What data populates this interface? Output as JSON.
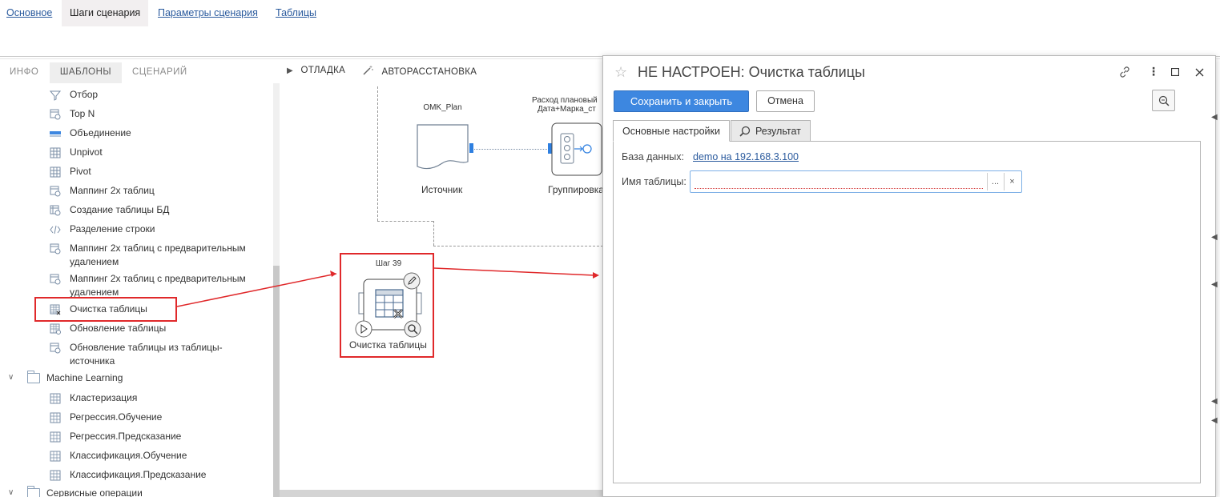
{
  "top_tabs": [
    "Основное",
    "Шаги сценария",
    "Параметры сценария",
    "Таблицы"
  ],
  "left_panel": {
    "tabs": [
      "ИНФО",
      "ШАБЛОНЫ",
      "СЦЕНАРИЙ"
    ],
    "items": [
      {
        "label": "Отбор",
        "icon": "filter-icon"
      },
      {
        "label": "Top N",
        "icon": "top-n-icon"
      },
      {
        "label": "Объединение",
        "icon": "union-icon"
      },
      {
        "label": "Unpivot",
        "icon": "unpivot-icon"
      },
      {
        "label": "Pivot",
        "icon": "pivot-icon"
      },
      {
        "label": "Маппинг 2х таблиц",
        "icon": "mapping-icon"
      },
      {
        "label": "Создание таблицы БД",
        "icon": "create-table-icon"
      },
      {
        "label": "Разделение строки",
        "icon": "code-icon"
      },
      {
        "label": "Маппинг 2х таблиц с предварительным удалением",
        "icon": "mapping-icon"
      },
      {
        "label": "Маппинг 2х таблиц с предварительным удалением",
        "icon": "mapping-icon"
      },
      {
        "label": "Очистка таблицы",
        "icon": "clear-table-icon"
      },
      {
        "label": "Обновление таблицы",
        "icon": "update-table-icon"
      },
      {
        "label": "Обновление таблицы из таблицы-источника",
        "icon": "mapping-icon"
      }
    ],
    "folders": [
      {
        "label": "Machine Learning",
        "items": [
          "Кластеризация",
          "Регрессия.Обучение",
          "Регрессия.Предсказание",
          "Классификация.Обучение",
          "Классификация.Предсказание"
        ]
      },
      {
        "label": "Сервисные операции",
        "items": []
      }
    ]
  },
  "toolbar": {
    "debug": "ОТЛАДКА",
    "auto_layout": "АВТОРАССТАНОВКА"
  },
  "canvas": {
    "source_node": {
      "title": "OMK_Plan",
      "label": "Источник"
    },
    "group_node": {
      "title": "Расход плановый",
      "title2": "Дата+Марка_ст",
      "label": "Группировка"
    },
    "step_node": {
      "title": "Шаг 39",
      "label": "Очистка таблицы"
    }
  },
  "dialog": {
    "title": "НЕ НАСТРОЕН: Очистка таблицы",
    "save_close": "Сохранить и закрыть",
    "cancel": "Отмена",
    "tabs": [
      "Основные настройки",
      "Результат"
    ],
    "db_label": "База данных:",
    "db_value": "demo на 192.168.3.100",
    "table_label": "Имя таблицы:",
    "table_value": "",
    "select_btn": "...",
    "clear_btn": "×"
  },
  "colors": {
    "accent": "#3d87e0",
    "link": "#2b5b9e",
    "highlight": "#e0292b",
    "node_port": "#2e7fe0"
  }
}
